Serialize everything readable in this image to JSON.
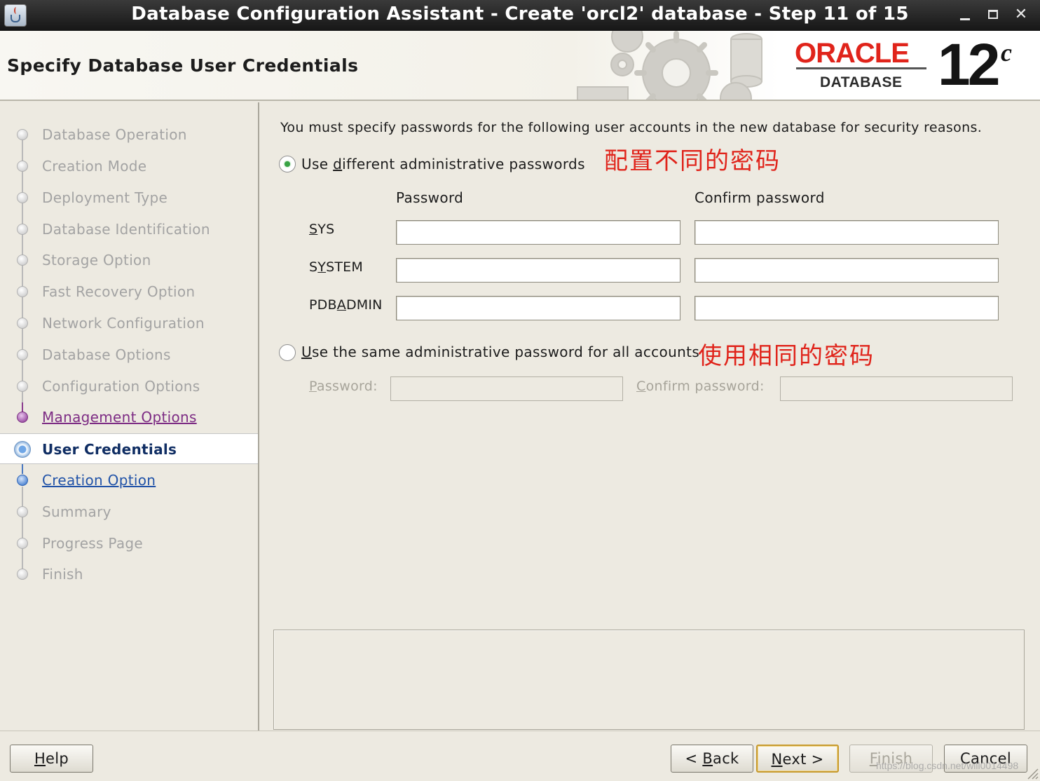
{
  "window": {
    "title": "Database Configuration Assistant - Create 'orcl2' database - Step 11 of 15",
    "app_icon": "java-app-icon",
    "controls": [
      "minimize-icon",
      "maximize-icon",
      "close-icon"
    ]
  },
  "header": {
    "title": "Specify Database User Credentials",
    "brand_name": "ORACLE",
    "brand_sub": "DATABASE",
    "version": "12",
    "version_suffix": "c",
    "brand_color": "#e0241b"
  },
  "steps": [
    {
      "label": "Database Operation",
      "state": "completed"
    },
    {
      "label": "Creation Mode",
      "state": "completed"
    },
    {
      "label": "Deployment Type",
      "state": "completed"
    },
    {
      "label": "Database Identification",
      "state": "completed"
    },
    {
      "label": "Storage Option",
      "state": "completed"
    },
    {
      "label": "Fast Recovery Option",
      "state": "completed"
    },
    {
      "label": "Network Configuration",
      "state": "completed"
    },
    {
      "label": "Database Options",
      "state": "completed"
    },
    {
      "label": "Configuration Options",
      "state": "completed"
    },
    {
      "label": "Management Options",
      "state": "visited-link"
    },
    {
      "label": "User Credentials",
      "state": "current"
    },
    {
      "label": "Creation Option",
      "state": "next-link"
    },
    {
      "label": "Summary",
      "state": "pending"
    },
    {
      "label": "Progress Page",
      "state": "pending"
    },
    {
      "label": "Finish",
      "state": "pending"
    }
  ],
  "content": {
    "intro": "You must specify passwords for the following user accounts in the new database for security reasons.",
    "option_different": {
      "pre": "Use ",
      "mnemonic": "d",
      "post": "ifferent administrative passwords",
      "selected": true,
      "annotation": "配置不同的密码"
    },
    "column_password": "Password",
    "column_confirm": "Confirm password",
    "accounts": [
      {
        "pre": "",
        "mnemonic": "S",
        "post": "YS",
        "password": "",
        "confirm": ""
      },
      {
        "pre": "S",
        "mnemonic": "Y",
        "post": "STEM",
        "password": "",
        "confirm": ""
      },
      {
        "pre": "PDB",
        "mnemonic": "A",
        "post": "DMIN",
        "password": "",
        "confirm": ""
      }
    ],
    "option_same": {
      "pre": "",
      "mnemonic": "U",
      "post": "se the same administrative password for all accounts",
      "selected": false,
      "annotation": "使用相同的密码"
    },
    "same_password_label": {
      "mnemonic": "P",
      "post": "assword:"
    },
    "same_confirm_label": {
      "mnemonic": "C",
      "post": "onfirm password:"
    },
    "same_password_value": "",
    "same_confirm_value": ""
  },
  "buttons": {
    "help": {
      "mnemonic": "H",
      "post": "elp"
    },
    "back": {
      "pre": "< ",
      "mnemonic": "B",
      "post": "ack"
    },
    "next": {
      "pre": "",
      "mnemonic": "N",
      "post": "ext >"
    },
    "finish": {
      "pre": "",
      "mnemonic": "F",
      "post": "inish"
    },
    "cancel": "Cancel"
  },
  "watermark": "https://blog.csdn.net/will0014498"
}
